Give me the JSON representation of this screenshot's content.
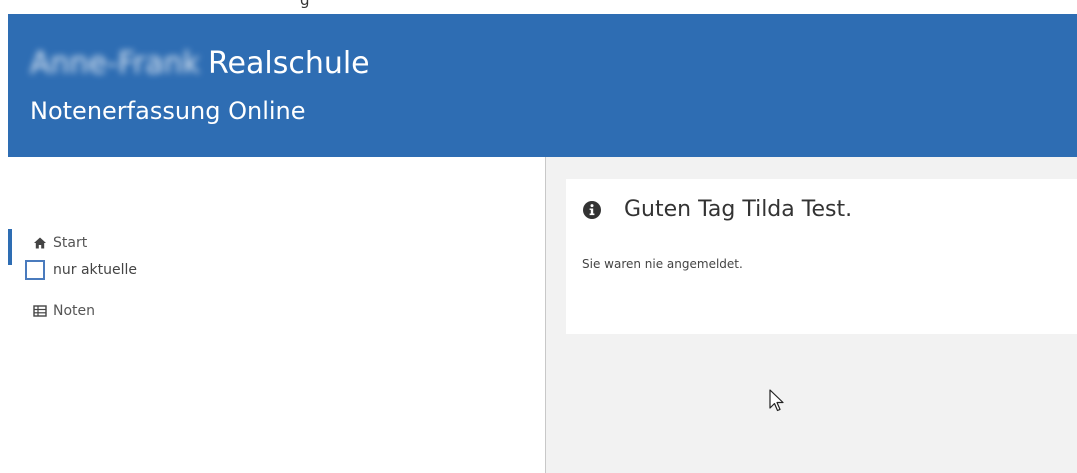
{
  "topstrip": {
    "text": "g"
  },
  "header": {
    "school_name_blurred": "Anne-Frank",
    "school_suffix": "Realschule",
    "subtitle": "Notenerfassung Online"
  },
  "sidebar": {
    "items": [
      {
        "label": "Start",
        "icon": "home-icon",
        "active": true
      },
      {
        "label": "Noten",
        "icon": "table-icon"
      }
    ],
    "checkbox": {
      "label": "nur aktuelle",
      "checked": false
    }
  },
  "main": {
    "card": {
      "icon": "info-icon",
      "title": "Guten Tag Tilda Test.",
      "text": "Sie waren nie angemeldet."
    }
  },
  "colors": {
    "header_bg": "#2e6db3",
    "main_bg": "#f2f2f2",
    "accent": "#2e6db3"
  }
}
